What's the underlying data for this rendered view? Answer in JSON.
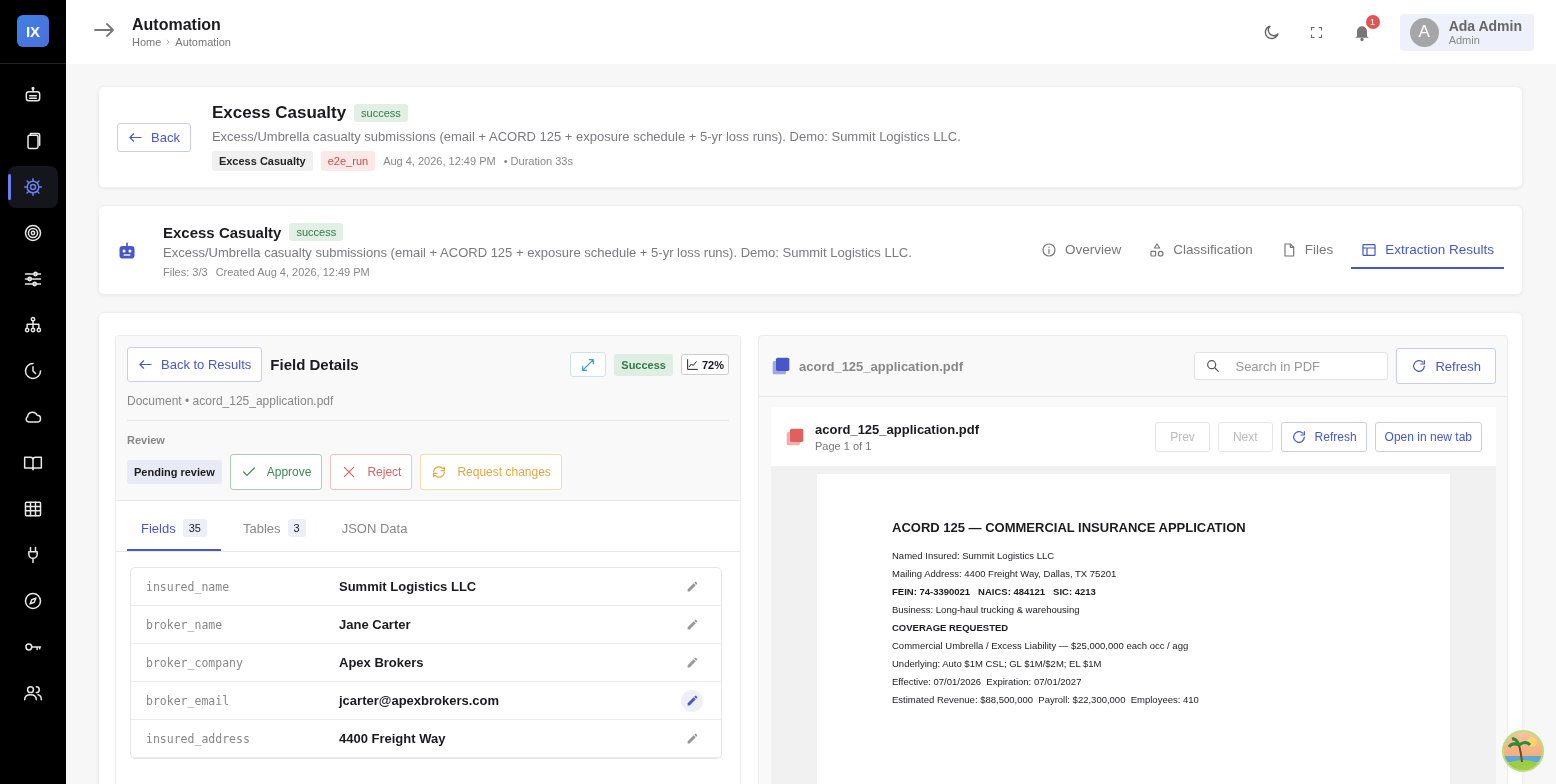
{
  "app": {
    "logo": "IX"
  },
  "sidebar": {
    "items": [
      {
        "selected": false
      },
      {
        "selected": false
      },
      {
        "selected": true
      },
      {
        "selected": false
      },
      {
        "selected": false
      },
      {
        "selected": false
      },
      {
        "selected": false
      },
      {
        "selected": false
      },
      {
        "selected": false
      },
      {
        "selected": false
      },
      {
        "selected": false
      },
      {
        "selected": false
      },
      {
        "selected": false
      },
      {
        "selected": false
      }
    ]
  },
  "header": {
    "title": "Automation",
    "breadcrumb": [
      "Home",
      "Automation"
    ],
    "notifications": "1",
    "user": {
      "initial": "A",
      "name": "Ada Admin",
      "role": "Admin"
    }
  },
  "run_card": {
    "back": "Back",
    "title": "Excess Casualty",
    "status": "success",
    "description": "Excess/Umbrella casualty submissions (email + ACORD 125 + exposure schedule + 5-yr loss runs). Demo: Summit Logistics LLC.",
    "tags": [
      {
        "label": "Excess Casualty",
        "kind": "neutral"
      },
      {
        "label": "e2e_run",
        "kind": "danger"
      }
    ],
    "date": "Aug 4, 2026, 12:49 PM",
    "duration": "• Duration 33s"
  },
  "automation_card": {
    "title": "Excess Casualty",
    "status": "success",
    "description": "Excess/Umbrella casualty submissions (email + ACORD 125 + exposure schedule + 5-yr loss runs). Demo: Summit Logistics LLC.",
    "files": "Files: 3/3",
    "created": "Created Aug 4, 2026, 12:49 PM",
    "tabs": [
      {
        "label": "Overview",
        "selected": false
      },
      {
        "label": "Classification",
        "selected": false
      },
      {
        "label": "Files",
        "selected": false
      },
      {
        "label": "Extraction Results",
        "selected": true
      }
    ]
  },
  "field_details": {
    "back": "Back to Results",
    "title": "Field Details",
    "status": "Success",
    "confidence": "72%",
    "subtitle": "Document • acord_125_application.pdf",
    "review_label": "Review",
    "review_status": "Pending review",
    "actions": [
      {
        "label": "Approve",
        "kind": "approve"
      },
      {
        "label": "Reject",
        "kind": "reject"
      },
      {
        "label": "Request changes",
        "kind": "changes"
      }
    ],
    "tabs": [
      {
        "label": "Fields",
        "count": "35",
        "selected": true
      },
      {
        "label": "Tables",
        "count": "3",
        "selected": false
      },
      {
        "label": "JSON Data",
        "selected": false
      }
    ],
    "fields": [
      {
        "name": "insured_name",
        "value": "Summit Logistics LLC",
        "selected": false
      },
      {
        "name": "broker_name",
        "value": "Jane Carter",
        "selected": false
      },
      {
        "name": "broker_company",
        "value": "Apex Brokers",
        "selected": false
      },
      {
        "name": "broker_email",
        "value": "jcarter@apexbrokers.com",
        "selected": true
      },
      {
        "name": "insured_address",
        "value": "4400 Freight Way",
        "selected": false
      }
    ]
  },
  "pdf_viewer": {
    "file": "acord_125_application.pdf",
    "search": {
      "placeholder": "Search in PDF"
    },
    "refresh": "Refresh",
    "title": "acord_125_application.pdf",
    "page": "Page 1 of 1",
    "buttons": [
      {
        "label": "Prev",
        "disabled": true,
        "kind": "plain"
      },
      {
        "label": "Next",
        "disabled": true,
        "kind": "plain"
      },
      {
        "label": "Refresh",
        "disabled": false,
        "kind": "refresh"
      },
      {
        "label": "Open in new tab",
        "disabled": false,
        "kind": "plain"
      }
    ],
    "document": [
      {
        "text": "ACORD 125 — COMMERCIAL INSURANCE APPLICATION",
        "kind": "title"
      },
      {
        "text": "Named Insured: Summit Logistics LLC",
        "kind": "line"
      },
      {
        "text": "Mailing Address: 4400 Freight Way, Dallas, TX 75201",
        "kind": "line"
      },
      {
        "text": "FEIN: 74-3390021   NAICS: 484121   SIC: 4213",
        "kind": "bold"
      },
      {
        "text": "Business: Long-haul trucking & warehousing",
        "kind": "line"
      },
      {
        "text": "COVERAGE REQUESTED",
        "kind": "bold"
      },
      {
        "text": "Commercial Umbrella / Excess Liability — $25,000,000 each occ / agg",
        "kind": "line"
      },
      {
        "text": "Underlying: Auto $1M CSL; GL $1M/$2M; EL $1M",
        "kind": "line"
      },
      {
        "text": "Effective: 07/01/2026  Expiration: 07/01/2027",
        "kind": "line"
      },
      {
        "text": "Estimated Revenue: $88,500,000  Payroll: $22,300,000  Employees: 410",
        "kind": "line"
      }
    ]
  }
}
